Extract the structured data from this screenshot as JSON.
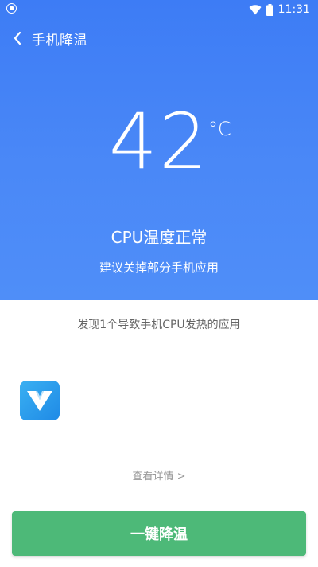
{
  "status_bar": {
    "time": "11:31",
    "icons": [
      "notification-icon",
      "wifi-icon",
      "battery-icon"
    ]
  },
  "header": {
    "title": "手机降温",
    "back_icon": "chevron-left-icon"
  },
  "temperature": {
    "value": "42",
    "unit": "°C",
    "status": "CPU温度正常",
    "advice": "建议关掉部分手机应用"
  },
  "apps_section": {
    "summary": "发现1个导致手机CPU发热的应用",
    "apps": [
      {
        "icon": "app-v-icon"
      }
    ],
    "details_link": "查看详情 >"
  },
  "action": {
    "button_label": "一键降温"
  },
  "colors": {
    "hero_blue": "#4a88f7",
    "button_green": "#4db978",
    "app_icon_blue": "#2a9af0"
  }
}
